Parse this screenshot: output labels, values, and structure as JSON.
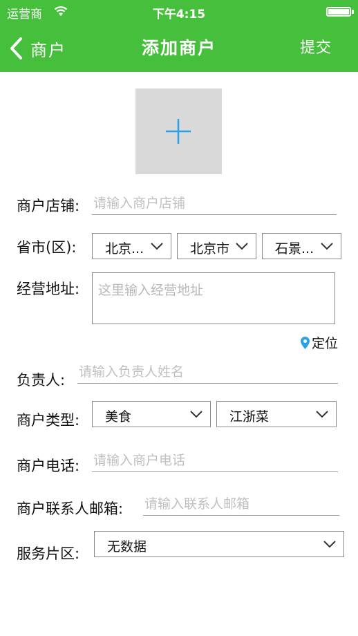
{
  "status_bar": {
    "carrier": "运营商",
    "time": "下午4:15"
  },
  "nav": {
    "back_label": "商户",
    "title": "添加商户",
    "submit_label": "提交"
  },
  "form": {
    "store": {
      "label": "商户店铺:",
      "placeholder": "请输入商户店铺"
    },
    "region": {
      "label": "省市(区):",
      "province": "北京...",
      "city": "北京市",
      "district": "石景..."
    },
    "address": {
      "label": "经营地址:",
      "placeholder": "这里输入经营地址",
      "locate_label": "定位"
    },
    "owner": {
      "label": "负责人:",
      "placeholder": "请输入负责人姓名"
    },
    "type": {
      "label": "商户类型:",
      "category": "美食",
      "subcategory": "江浙菜"
    },
    "phone": {
      "label": "商户电话:",
      "placeholder": "请输入商户电话"
    },
    "email": {
      "label": "商户联系人邮箱:",
      "placeholder": "请输入联系人邮箱"
    },
    "area": {
      "label": "服务片区:",
      "value": "无数据"
    }
  },
  "colors": {
    "brand_green": "#46bf3c",
    "accent_blue": "#2aa0e8"
  }
}
